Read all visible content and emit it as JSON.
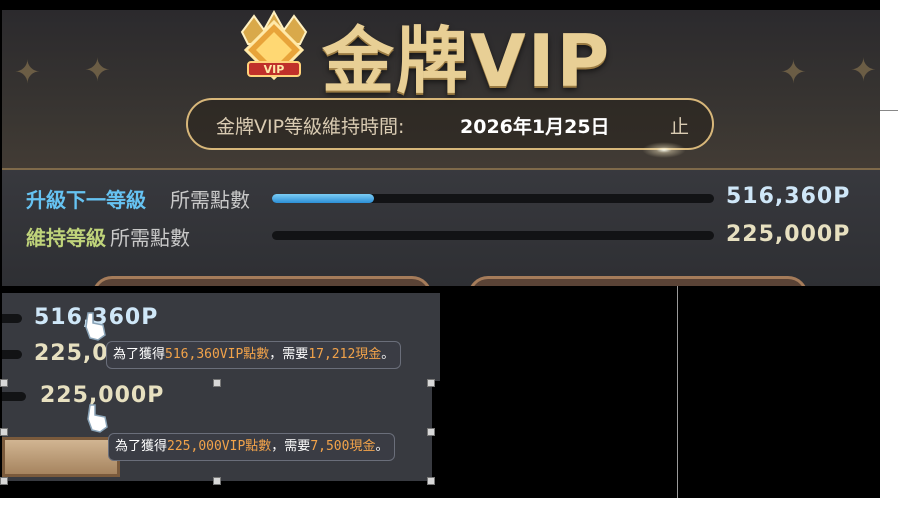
{
  "top_panel": {
    "title": "金牌VIP",
    "crown_badge": "VIP",
    "maintain_label": "金牌VIP等級維持時間:",
    "maintain_date": "2026年1月25日",
    "maintain_suffix": "止",
    "rows": [
      {
        "label_main": "升級下一等級",
        "label_sub": "所需點數",
        "value": "516,360P",
        "progress": 0.23,
        "label_color": "#66c3f2",
        "value_color": "#cfe7f8"
      },
      {
        "label_main": "維持等級",
        "label_sub": "所需點數",
        "value": "225,000P",
        "progress": 0.0,
        "label_color": "#bfd37a",
        "value_color": "#e7e0c0"
      }
    ]
  },
  "zoom": {
    "value1": "516,360P",
    "value2_partial": "225,0",
    "value3": "225,000P",
    "tooltip1": {
      "prefix": "為了獲得",
      "points": "516,360VIP點數",
      "mid": "，需要",
      "cash": "17,212現金",
      "end": "。"
    },
    "tooltip2": {
      "prefix": "為了獲得",
      "points": "225,000VIP點數",
      "mid": "，需要",
      "cash": "7,500現金",
      "end": "。"
    }
  }
}
